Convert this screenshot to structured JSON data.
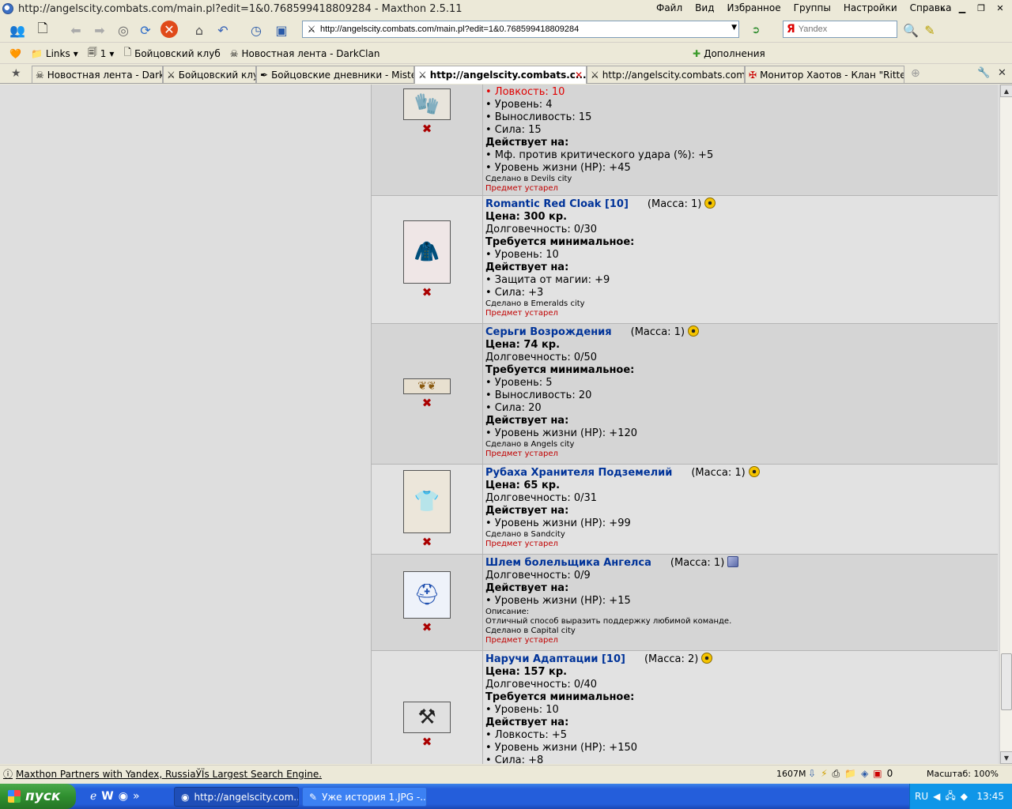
{
  "window": {
    "title": "http://angelscity.combats.com/main.pl?edit=1&0.768599418809284 - Maxthon 2.5.11",
    "menu": [
      "Файл",
      "Вид",
      "Избранное",
      "Группы",
      "Настройки",
      "Справка"
    ]
  },
  "toolbar": {
    "url": "http://angelscity.combats.com/main.pl?edit=1&0.768599418809284",
    "search_placeholder": "Yandex"
  },
  "links": {
    "items": [
      "Links",
      "1",
      "Бойцовский клуб",
      "Новостная лента - DarkClan"
    ],
    "addons": "Дополнения"
  },
  "tabs": [
    {
      "label": "Новостная лента - DarkClan",
      "active": false
    },
    {
      "label": "Бойцовский клуб",
      "active": false
    },
    {
      "label": "Бойцовские дневники - Mistero...",
      "active": false
    },
    {
      "label": "http://angelscity.combats.c...",
      "active": true
    },
    {
      "label": "http://angelscity.combats.com/l...",
      "active": false
    },
    {
      "label": "Монитор Хаотов - Клан \"Ritter ...",
      "active": false
    }
  ],
  "items": [
    {
      "name": "",
      "lines": [
        {
          "t": "• Ловкость: 10",
          "c": "red"
        },
        {
          "t": "• Уровень: 4"
        },
        {
          "t": "• Выносливость: 15"
        },
        {
          "t": "• Сила: 15"
        },
        {
          "t": "Действует на:",
          "c": "b"
        },
        {
          "t": "• Мф. против критического удара (%): +5"
        },
        {
          "t": "• Уровень жизни (HP): +45"
        }
      ],
      "made": "Сделано в Devils city",
      "obsolete": "Предмет устарел",
      "icon": "gloves-icon"
    },
    {
      "name": "Romantic Red Cloak [10]",
      "mass": "(Масса: 1)",
      "lines": [
        {
          "t": "Цена: 300 кр.",
          "c": "b"
        },
        {
          "t": "Долговечность: 0/30"
        },
        {
          "t": "Требуется минимальное:",
          "c": "b"
        },
        {
          "t": "• Уровень: 10"
        },
        {
          "t": "Действует на:",
          "c": "b"
        },
        {
          "t": "• Защита от магии: +9"
        },
        {
          "t": "• Сила: +3"
        }
      ],
      "made": "Сделано в Emeralds city",
      "obsolete": "Предмет устарел",
      "icon": "cloak-icon"
    },
    {
      "name": "Серьги Возрождения",
      "mass": "(Масса: 1)",
      "lines": [
        {
          "t": "Цена: 74 кр.",
          "c": "b"
        },
        {
          "t": "Долговечность: 0/50"
        },
        {
          "t": "Требуется минимальное:",
          "c": "b"
        },
        {
          "t": "• Уровень: 5"
        },
        {
          "t": "• Выносливость: 20"
        },
        {
          "t": "• Сила: 20"
        },
        {
          "t": "Действует на:",
          "c": "b"
        },
        {
          "t": "• Уровень жизни (HP): +120"
        }
      ],
      "made": "Сделано в Angels city",
      "obsolete": "Предмет устарел",
      "icon": "earrings-icon"
    },
    {
      "name": "Рубаха Хранителя Подземелий",
      "mass": "(Масса: 1)",
      "lines": [
        {
          "t": "Цена: 65 кр.",
          "c": "b"
        },
        {
          "t": "Долговечность: 0/31"
        },
        {
          "t": "Действует на:",
          "c": "b"
        },
        {
          "t": "• Уровень жизни (HP): +99"
        }
      ],
      "made": "Сделано в Sandcity",
      "obsolete": "Предмет устарел",
      "icon": "shirt-icon"
    },
    {
      "name": "Шлем болельщика Ангелса",
      "mass": "(Масса: 1)",
      "lines": [
        {
          "t": "Долговечность: 0/9"
        },
        {
          "t": "Действует на:",
          "c": "b"
        },
        {
          "t": "• Уровень жизни (HP): +15"
        },
        {
          "t": "Описание:",
          "c": "small"
        },
        {
          "t": "Отличный способ выразить поддержку любимой команде.",
          "c": "small"
        }
      ],
      "made": "Сделано в Capital city",
      "obsolete": "Предмет устарел",
      "icon": "helmet-icon"
    },
    {
      "name": "Наручи Адаптации [10]",
      "mass": "(Масса: 2)",
      "lines": [
        {
          "t": "Цена: 157 кр.",
          "c": "b"
        },
        {
          "t": "Долговечность: 0/40"
        },
        {
          "t": "Требуется минимальное:",
          "c": "b"
        },
        {
          "t": "• Уровень: 10"
        },
        {
          "t": "Действует на:",
          "c": "b"
        },
        {
          "t": "• Ловкость: +5"
        },
        {
          "t": "• Уровень жизни (HP): +150"
        },
        {
          "t": "• Сила: +8"
        }
      ],
      "made": "",
      "obsolete": "",
      "icon": "bracers-icon"
    }
  ],
  "status": {
    "message": "Maxthon Partners with Yandex, RussiaЎЇs Largest Search Engine.",
    "memory": "1607M",
    "counter": "0",
    "zoom": "Масштаб: 100%"
  },
  "taskbar": {
    "start": "пуск",
    "buttons": [
      "http://angelscity.com....",
      "Уже история 1.JPG -..."
    ],
    "lang": "RU",
    "clock": "13:45"
  }
}
